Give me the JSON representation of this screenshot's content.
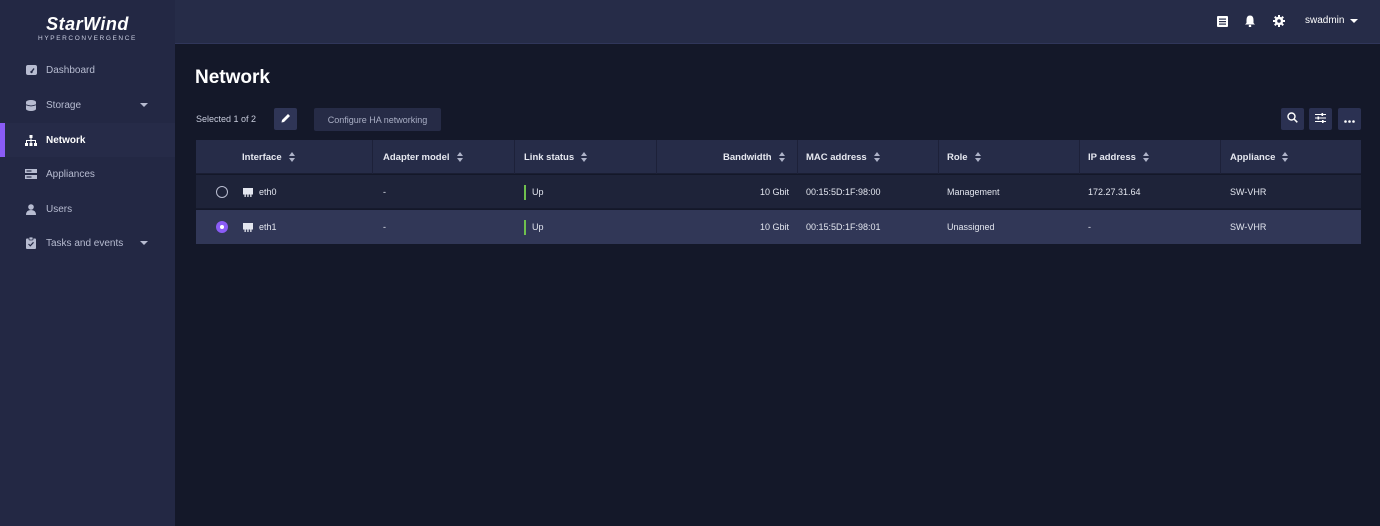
{
  "brand": {
    "name": "StarWind",
    "tagline": "HYPERCONVERGENCE"
  },
  "sidebar": {
    "items": [
      {
        "label": "Dashboard",
        "icon": "dashboard-icon"
      },
      {
        "label": "Storage",
        "icon": "storage-icon",
        "expandable": true
      },
      {
        "label": "Network",
        "icon": "network-icon",
        "active": true
      },
      {
        "label": "Appliances",
        "icon": "appliances-icon"
      },
      {
        "label": "Users",
        "icon": "user-icon"
      },
      {
        "label": "Tasks and events",
        "icon": "tasks-icon",
        "expandable": true
      }
    ]
  },
  "topbar": {
    "icons": [
      "list-icon",
      "bell-icon",
      "gear-icon"
    ],
    "user": "swadmin"
  },
  "page": {
    "title": "Network",
    "selection": "Selected 1 of 2",
    "configure_ha": "Configure HA networking"
  },
  "table": {
    "columns": [
      "Interface",
      "Adapter model",
      "Link status",
      "Bandwidth",
      "MAC address",
      "Role",
      "IP address",
      "Appliance"
    ],
    "rows": [
      {
        "selected": false,
        "interface": "eth0",
        "adapter_model": "-",
        "link_status": "Up",
        "bandwidth": "10 Gbit",
        "mac": "00:15:5D:1F:98:00",
        "role": "Management",
        "ip": "172.27.31.64",
        "appliance": "SW-VHR"
      },
      {
        "selected": true,
        "interface": "eth1",
        "adapter_model": "-",
        "link_status": "Up",
        "bandwidth": "10 Gbit",
        "mac": "00:15:5D:1F:98:01",
        "role": "Unassigned",
        "ip": "-",
        "appliance": "SW-VHR"
      }
    ]
  },
  "colors": {
    "accent": "#8a5cf6",
    "link_up": "#6fc04e",
    "background": "#141829",
    "sidebar": "#232844"
  }
}
